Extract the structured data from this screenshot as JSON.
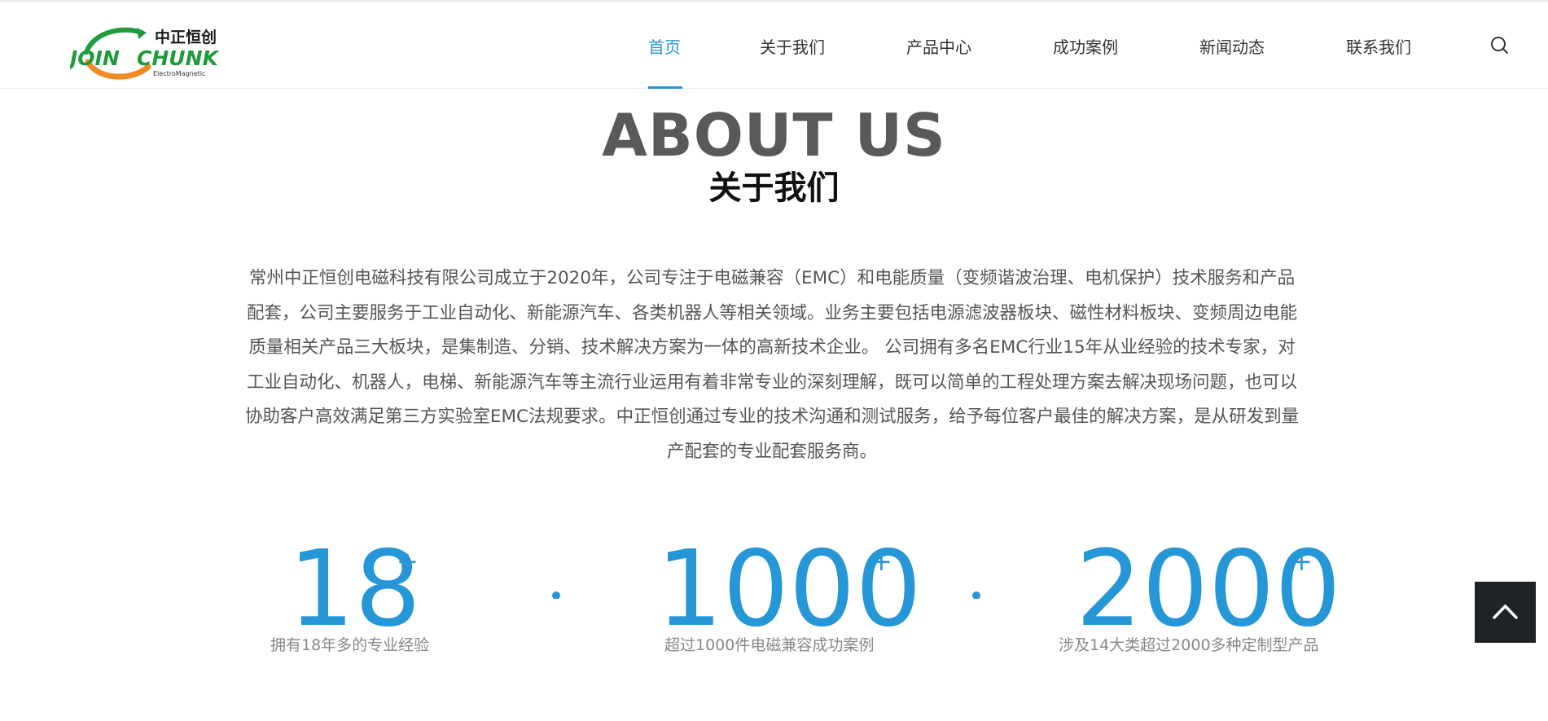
{
  "header": {
    "logo": {
      "cn_text": "中正恒创",
      "en_text": "JOIN CHUNK",
      "sub_text": "ElectroMagnetic"
    },
    "nav": [
      {
        "label": "首页",
        "active": true
      },
      {
        "label": "关于我们",
        "active": false
      },
      {
        "label": "产品中心",
        "active": false
      },
      {
        "label": "成功案例",
        "active": false
      },
      {
        "label": "新闻动态",
        "active": false
      },
      {
        "label": "联系我们",
        "active": false
      }
    ],
    "search_icon": "search-icon"
  },
  "about": {
    "title_en": "ABOUT US",
    "title_cn": "关于我们",
    "description": "常州中正恒创电磁科技有限公司成立于2020年，公司专注于电磁兼容（EMC）和电能质量（变频谐波治理、电机保护）技术服务和产品配套，公司主要服务于工业自动化、新能源汽车、各类机器人等相关领域。业务主要包括电源滤波器板块、磁性材料板块、变频周边电能质量相关产品三大板块，是集制造、分销、技术解决方案为一体的高新技术企业。 公司拥有多名EMC行业15年从业经验的技术专家，对工业自动化、机器人，电梯、新能源汽车等主流行业运用有着非常专业的深刻理解，既可以简单的工程处理方案去解决现场问题，也可以协助客户高效满足第三方实验室EMC法规要求。中正恒创通过专业的技术沟通和测试服务，给予每位客户最佳的解决方案，是从研发到量产配套的专业配套服务商。"
  },
  "stats": [
    {
      "value": "18",
      "suffix": "+",
      "label": "拥有18年多的专业经验"
    },
    {
      "value": "1000",
      "suffix": "+",
      "label": "超过1000件电磁兼容成功案例"
    },
    {
      "value": "2000",
      "suffix": "+",
      "label": "涉及14大类超过2000多种定制型产品"
    }
  ],
  "colors": {
    "accent": "#2596d6",
    "logo_green": "#1f9a3c",
    "logo_orange": "#f08a24",
    "back_top_bg": "#1f2326"
  },
  "back_to_top_icon": "chevron-up-icon"
}
